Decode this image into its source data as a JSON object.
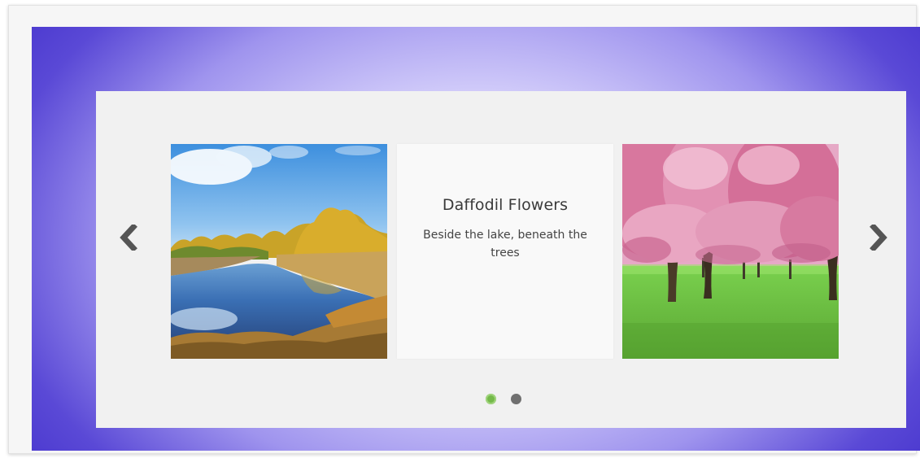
{
  "carousel": {
    "prev_icon": "chevron-left-icon",
    "next_icon": "chevron-right-icon",
    "slides": [
      {
        "kind": "image",
        "subject": "lake-landscape"
      },
      {
        "kind": "caption",
        "title": "Daffodil Flowers",
        "text": "Beside the lake, beneath the trees"
      },
      {
        "kind": "image",
        "subject": "cherry-blossom-trees"
      }
    ],
    "pagination": {
      "count": 2,
      "active_index": 0,
      "active_color": "#74b94a",
      "inactive_color": "#707070"
    }
  },
  "colors": {
    "background_outer": "#4b39cf",
    "background_center": "#f4f2ff",
    "panel": "#f1f1f1",
    "arrow": "#555555"
  }
}
